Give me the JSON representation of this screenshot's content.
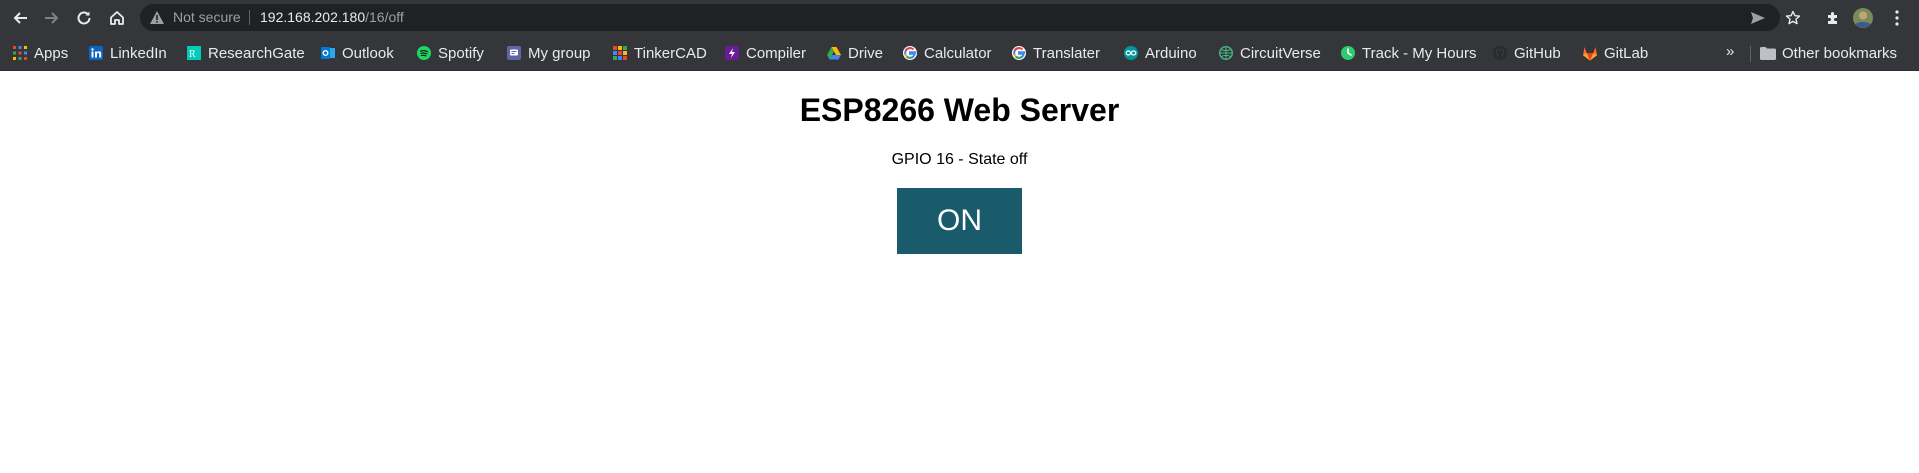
{
  "browser": {
    "security_label": "Not secure",
    "url_host": "192.168.202.180",
    "url_path": "/16/off",
    "nav_icons": [
      "back-icon",
      "forward-icon",
      "reload-icon",
      "home-icon"
    ],
    "right_icons": [
      "send-icon",
      "star-icon",
      "extensions-icon",
      "profile-avatar",
      "menu-icon"
    ]
  },
  "bookmarks": {
    "items": [
      {
        "label": "Apps",
        "icon": "apps-grid-icon",
        "color": "#ea4335"
      },
      {
        "label": "LinkedIn",
        "icon": "linkedin-icon",
        "color": "#0a66c2"
      },
      {
        "label": "ResearchGate",
        "icon": "researchgate-icon",
        "color": "#00ccbb"
      },
      {
        "label": "Outlook",
        "icon": "outlook-icon",
        "color": "#0078d4"
      },
      {
        "label": "Spotify",
        "icon": "spotify-icon",
        "color": "#1ed760"
      },
      {
        "label": "My group",
        "icon": "mygroup-icon",
        "color": "#6264a7"
      },
      {
        "label": "TinkerCAD",
        "icon": "tinkercad-icon",
        "color": "#f4b400"
      },
      {
        "label": "Compiler",
        "icon": "compiler-icon",
        "color": "#6a1b9a"
      },
      {
        "label": "Drive",
        "icon": "drive-icon",
        "color": "#fbbc04"
      },
      {
        "label": "Calculator",
        "icon": "google-icon",
        "color": "#4285f4"
      },
      {
        "label": "Translater",
        "icon": "google-icon",
        "color": "#4285f4"
      },
      {
        "label": "Arduino",
        "icon": "arduino-icon",
        "color": "#00979d"
      },
      {
        "label": "CircuitVerse",
        "icon": "circuitverse-icon",
        "color": "#42b883"
      },
      {
        "label": "Track - My Hours",
        "icon": "trackmyhours-icon",
        "color": "#2ecc71"
      },
      {
        "label": "GitHub",
        "icon": "github-icon",
        "color": "#24292e"
      },
      {
        "label": "GitLab",
        "icon": "gitlab-icon",
        "color": "#fc6d26"
      }
    ],
    "more_label": "»",
    "other_label": "Other bookmarks"
  },
  "page": {
    "title": "ESP8266 Web Server",
    "state_text": "GPIO 16 - State off",
    "button_label": "ON",
    "button_color": "#195b6a"
  }
}
